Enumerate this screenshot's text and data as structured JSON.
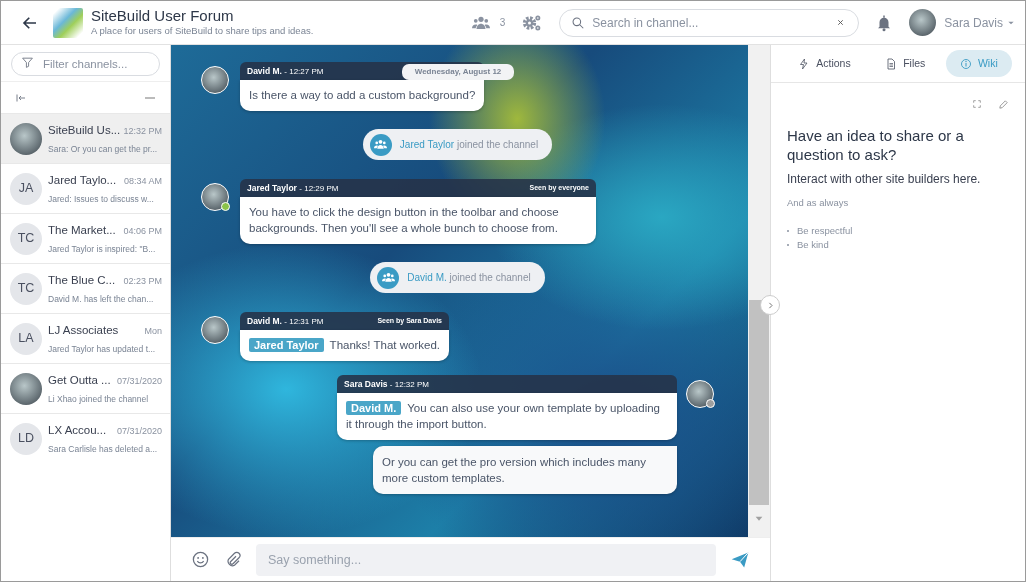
{
  "header": {
    "title": "SiteBuild User Forum",
    "subtitle": "A place for users of SiteBuild to share tips and ideas.",
    "member_count": "3",
    "search": {
      "placeholder": "Search in channel..."
    },
    "user_name": "Sara Davis"
  },
  "sidebar": {
    "filter": {
      "placeholder": "Filter channels..."
    },
    "channels": [
      {
        "name": "SiteBuild Us...",
        "time": "12:32 PM",
        "preview": "Sara: Or you can get the pr...",
        "avatar": {
          "kind": "photo"
        },
        "selected": true
      },
      {
        "name": "Jared Taylo...",
        "time": "08:34 AM",
        "preview": "Jared: Issues to discuss w...",
        "avatar": {
          "kind": "initials",
          "text": "JA"
        },
        "selected": false
      },
      {
        "name": "The Market...",
        "time": "04:06 PM",
        "preview": "Jared Taylor is inspired: \"B...",
        "avatar": {
          "kind": "initials",
          "text": "TC"
        },
        "selected": false
      },
      {
        "name": "The Blue C...",
        "time": "02:23 PM",
        "preview": "David M. has left the chan...",
        "avatar": {
          "kind": "initials",
          "text": "TC"
        },
        "selected": false
      },
      {
        "name": "LJ Associates",
        "time": "Mon",
        "preview": "Jared Taylor has updated t...",
        "avatar": {
          "kind": "initials",
          "text": "LA"
        },
        "selected": false
      },
      {
        "name": "Get Outta ...",
        "time": "07/31/2020",
        "preview": "Li Xhao joined the channel",
        "avatar": {
          "kind": "photo"
        },
        "selected": false
      },
      {
        "name": "LX Accou...",
        "time": "07/31/2020",
        "preview": "Sara Carlisle has deleted a...",
        "avatar": {
          "kind": "initials",
          "text": "LD"
        },
        "selected": false
      }
    ]
  },
  "chat": {
    "date_label": "Wednesday, August 12",
    "messages": [
      {
        "kind": "message",
        "author": "David M.",
        "time": "- 12:27 PM",
        "text": "Is there a way to add a custom background?"
      },
      {
        "kind": "event",
        "user": "Jared Taylor",
        "text": "joined the channel"
      },
      {
        "kind": "message",
        "author": "Jared Taylor",
        "time": "- 12:29 PM",
        "seen": "Seen by everyone",
        "status_dot": {
          "color": "#8bc34a"
        },
        "text": "You have to click the design button in the toolbar and choose backgrounds. Then you'll see a whole bunch to choose from."
      },
      {
        "kind": "event",
        "user": "David M.",
        "text": "joined the channel"
      },
      {
        "kind": "message",
        "author": "David M.",
        "time": "- 12:31 PM",
        "seen": "Seen by Sara Davis",
        "mention": "Jared Taylor",
        "text": "Thanks! That worked."
      },
      {
        "kind": "own_message",
        "author": "Sara Davis",
        "time": "- 12:32 PM",
        "status_dot": {
          "color": "#9e9e9e"
        },
        "mention": "David M.",
        "text": "You can also use your own template by uploading it through the import button."
      },
      {
        "kind": "own_continuation",
        "text": "Or you can get the pro version which includes many more custom templates."
      }
    ],
    "composer": {
      "placeholder": "Say something..."
    }
  },
  "panel": {
    "tabs": [
      {
        "label": "Actions",
        "selected": false
      },
      {
        "label": "Files",
        "selected": false
      },
      {
        "label": "Wiki",
        "selected": true
      }
    ],
    "wiki": {
      "heading": "Have an idea to share or a question to ask?",
      "subheading": "Interact with other site builders here.",
      "note": "And as always",
      "bullets": [
        "Be respectful",
        "Be kind"
      ]
    }
  }
}
